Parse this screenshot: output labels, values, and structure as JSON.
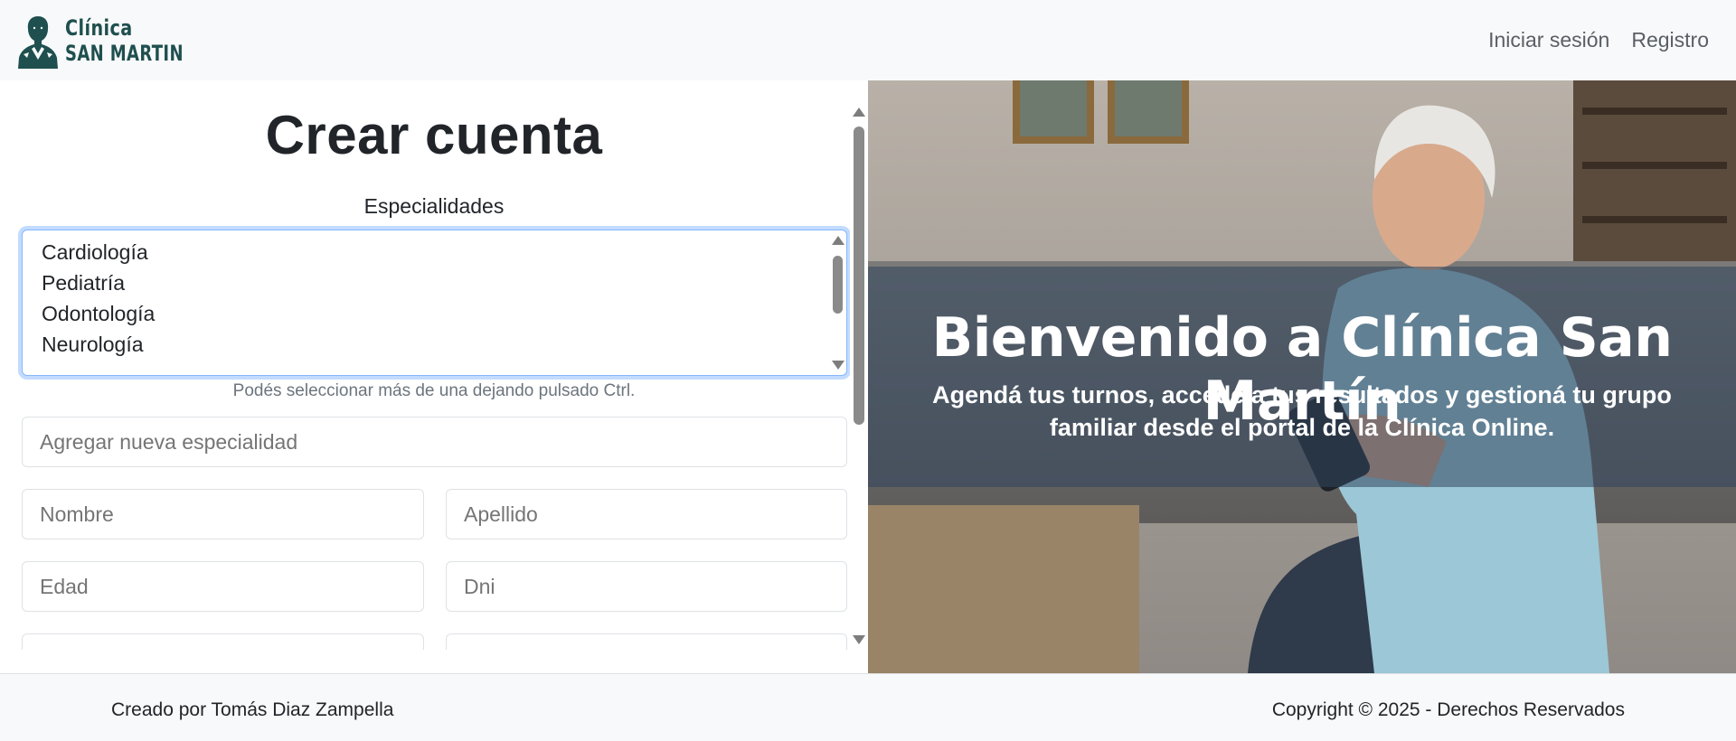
{
  "navbar": {
    "brand_line1": "Clínica",
    "brand_line2": "SAN MARTIN",
    "brand_color": "#1f4f4f",
    "links": [
      "Iniciar sesión",
      "Registro"
    ]
  },
  "form": {
    "title": "Crear cuenta",
    "specialties_label": "Especialidades",
    "specialties_options": [
      "Cardiología",
      "Pediatría",
      "Odontología",
      "Neurología"
    ],
    "help_text": "Podés seleccionar más de una dejando pulsado Ctrl.",
    "new_specialty_placeholder": "Agregar nueva especialidad",
    "nombre_placeholder": "Nombre",
    "apellido_placeholder": "Apellido",
    "edad_placeholder": "Edad",
    "dni_placeholder": "Dni"
  },
  "hero": {
    "title": "Bienvenido a Clínica San Martín",
    "subtitle": "Agendá tus turnos, accedé a tus resultados y gestioná tu grupo familiar desde el portal de la Clínica Online."
  },
  "footer": {
    "credit": "Creado por Tomás Diaz Zampella",
    "copyright": "Copyright © 2025 - Derechos Reservados"
  }
}
